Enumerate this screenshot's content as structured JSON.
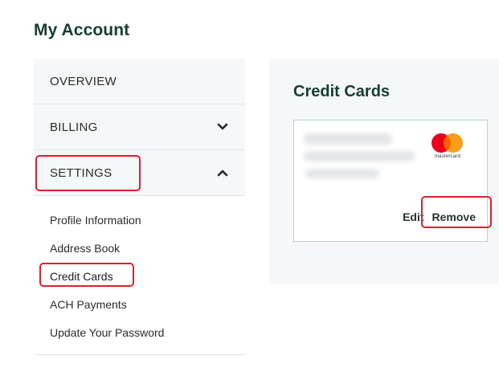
{
  "page": {
    "title": "My Account"
  },
  "sidebar": {
    "items": [
      {
        "label": "OVERVIEW"
      },
      {
        "label": "BILLING",
        "icon": "chevron-down-icon"
      },
      {
        "label": "SETTINGS",
        "icon": "chevron-up-icon"
      }
    ],
    "settings_subitems": [
      {
        "label": "Profile Information"
      },
      {
        "label": "Address Book"
      },
      {
        "label": "Credit Cards"
      },
      {
        "label": "ACH Payments"
      },
      {
        "label": "Update Your Password"
      }
    ]
  },
  "panel": {
    "title": "Credit Cards",
    "card": {
      "brand_text": "mastercard",
      "edit_label": "Edit",
      "remove_label": "Remove"
    }
  },
  "colors": {
    "heading": "#173d33",
    "highlight": "#e0202a",
    "card_border": "#b8d2da",
    "panel_bg": "#f5f7f8"
  }
}
